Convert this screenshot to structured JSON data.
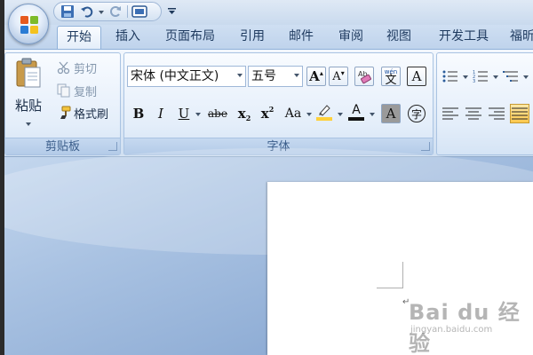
{
  "tabs": [
    {
      "label": "开始",
      "active": true
    },
    {
      "label": "插入"
    },
    {
      "label": "页面布局"
    },
    {
      "label": "引用"
    },
    {
      "label": "邮件"
    },
    {
      "label": "审阅"
    },
    {
      "label": "视图"
    },
    {
      "label": "开发工具"
    },
    {
      "label": "福昕"
    }
  ],
  "clipboard": {
    "paste_label": "粘贴",
    "cut_label": "剪切",
    "copy_label": "复制",
    "format_painter_label": "格式刷",
    "group_label": "剪贴板"
  },
  "font": {
    "font_name": "宋体 (中文正文)",
    "font_size": "五号",
    "group_label": "字体",
    "bold": "B",
    "italic": "I",
    "underline": "U",
    "strike": "abe",
    "subscript": "x",
    "superscript": "x",
    "case": "Aa",
    "grow": "A",
    "shrink": "A",
    "char_border": "A",
    "char_shading": "A",
    "enclose": "字",
    "phonetic": "文",
    "phonetic_top": "wén"
  },
  "watermark": {
    "main": "Bai du 经验",
    "sub": "jingyan.baidu.com"
  },
  "colors": {
    "accent": "#4f7fb9",
    "highlight": "#ffd03a",
    "font_color": "#e01e1e"
  }
}
